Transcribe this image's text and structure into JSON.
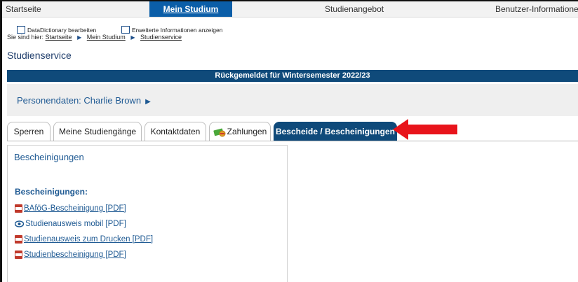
{
  "topnav": {
    "items": [
      {
        "label": "Startseite"
      },
      {
        "label": "Mein Studium"
      },
      {
        "label": "Studienangebot"
      },
      {
        "label": "Benutzer-Informatione"
      }
    ]
  },
  "options": {
    "datadictionary": "DataDictionary bearbeiten",
    "erweitert": "Erweiterte Informationen anzeigen"
  },
  "breadcrumb": {
    "prefix": "Sie sind hier:",
    "items": [
      "Startseite",
      "Mein Studium",
      "Studienservice"
    ]
  },
  "page_title": "Studienservice",
  "status_bar": "Rückgemeldet für Wintersemester 2022/23",
  "person": {
    "label": "Personendaten: Charlie Brown"
  },
  "tabs": [
    {
      "label": "Sperren"
    },
    {
      "label": "Meine Studiengänge"
    },
    {
      "label": "Kontaktdaten"
    },
    {
      "label": "Zahlungen"
    },
    {
      "label": "Bescheide / Bescheinigungen"
    }
  ],
  "panel": {
    "title": "Bescheinigungen",
    "section": "Bescheinigungen:",
    "links": [
      {
        "label": "BAföG-Bescheinigung [PDF]",
        "icon": "pdf-icon"
      },
      {
        "label": "Studienausweis mobil [PDF]",
        "icon": "eye-icon"
      },
      {
        "label": "Studienausweis zum Drucken [PDF]",
        "icon": "pdf-icon"
      },
      {
        "label": "Studienbescheinigung [PDF]",
        "icon": "pdf-icon"
      }
    ]
  },
  "colors": {
    "nav_active": "#0b5ea8",
    "status_bar": "#0f4a7a",
    "link": "#1f5a93",
    "arrow": "#e8141b"
  }
}
